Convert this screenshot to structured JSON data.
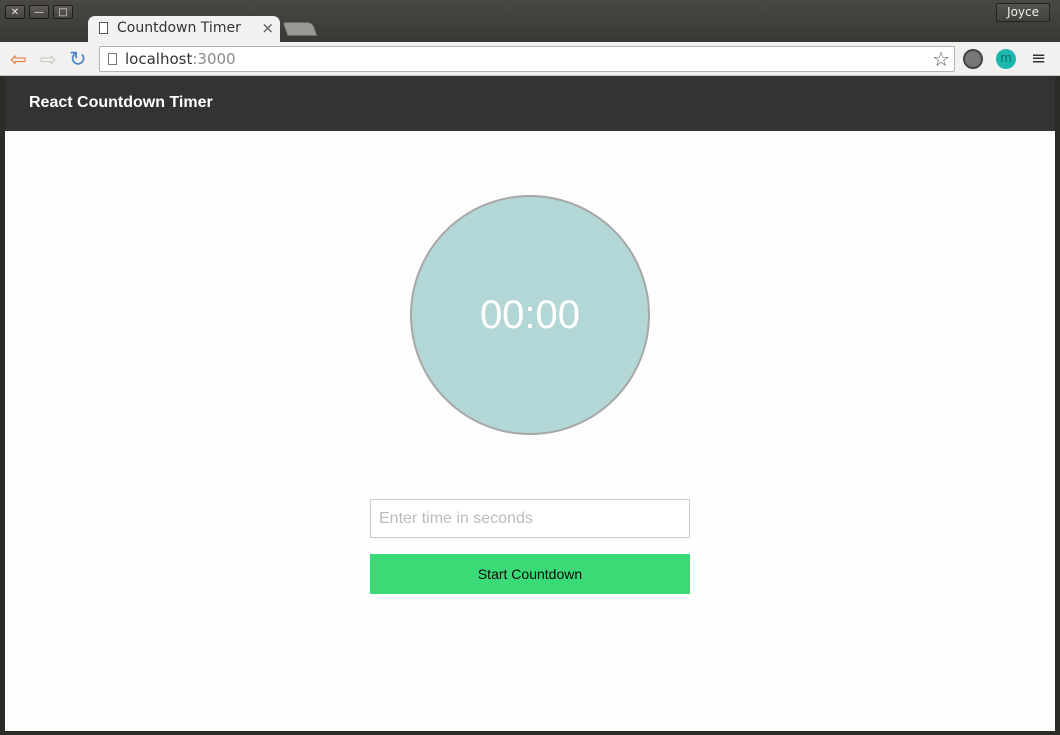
{
  "window": {
    "profile_name": "Joyce",
    "buttons": [
      "✕",
      "—",
      "□"
    ]
  },
  "tab": {
    "title": "Countdown Timer",
    "close_glyph": "×"
  },
  "address_bar": {
    "host": "localhost",
    "port": ":3000"
  },
  "extensions": {
    "m_label": "m"
  },
  "navbar": {
    "brand": "React Countdown Timer"
  },
  "clock": {
    "display": "00:00"
  },
  "form": {
    "placeholder": "Enter time in seconds",
    "value": "",
    "button_label": "Start Countdown"
  },
  "colors": {
    "navbar_bg": "#333333",
    "clock_bg": "#b2d7d6",
    "button_bg": "#3adb76"
  },
  "icons": [
    "page-icon",
    "back-arrow-icon",
    "forward-arrow-icon",
    "reload-icon",
    "star-icon",
    "film-reel-icon",
    "menu-icon"
  ]
}
